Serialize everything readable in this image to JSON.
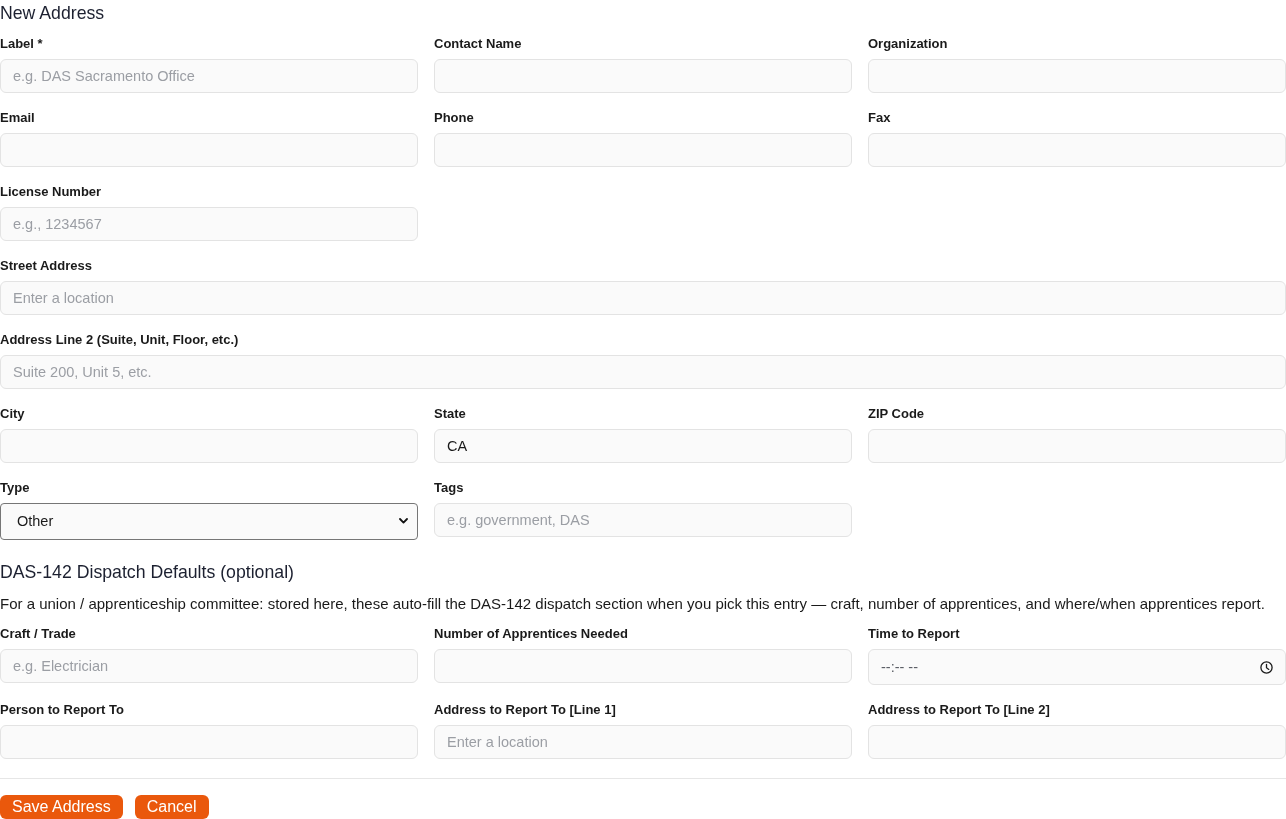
{
  "page": {
    "title": "New Address"
  },
  "sections": [
    {
      "rows": [
        {
          "fields": [
            {
              "label": "Label *",
              "kind": "text",
              "placeholder": "e.g. DAS Sacramento Office"
            },
            {
              "label": "Contact Name",
              "kind": "text"
            },
            {
              "label": "Organization",
              "kind": "text"
            }
          ]
        },
        {
          "fields": [
            {
              "label": "Email",
              "kind": "text"
            },
            {
              "label": "Phone",
              "kind": "text"
            },
            {
              "label": "Fax",
              "kind": "text"
            }
          ]
        },
        {
          "fields": [
            {
              "label": "License Number",
              "kind": "text",
              "placeholder": "e.g., 1234567"
            }
          ]
        },
        {
          "fields": [
            {
              "label": "Street Address",
              "kind": "text",
              "placeholder": "Enter a location"
            }
          ]
        },
        {
          "fields": [
            {
              "label": "Address Line 2 (Suite, Unit, Floor, etc.)",
              "kind": "text",
              "placeholder": "Suite 200, Unit 5, etc."
            }
          ]
        },
        {
          "fields": [
            {
              "label": "City",
              "kind": "text"
            },
            {
              "label": "State",
              "kind": "text",
              "value": "CA"
            },
            {
              "label": "ZIP Code",
              "kind": "text"
            }
          ]
        },
        {
          "fields": [
            {
              "label": "Type",
              "kind": "select",
              "value": "Other"
            },
            {
              "label": "Tags",
              "kind": "text",
              "placeholder": "e.g. government, DAS"
            }
          ]
        }
      ]
    },
    {
      "title": "DAS-142 Dispatch Defaults (optional)",
      "description": "For a union / apprenticeship committee: stored here, these auto-fill the DAS-142 dispatch section when you pick this entry — craft, number of apprentices, and where/when apprentices report.",
      "rows": [
        {
          "fields": [
            {
              "label": "Craft / Trade",
              "kind": "text",
              "placeholder": "e.g. Electrician"
            },
            {
              "label": "Number of Apprentices Needed",
              "kind": "text"
            },
            {
              "label": "Time to Report",
              "kind": "time",
              "placeholder": "--:-- --"
            }
          ]
        },
        {
          "fields": [
            {
              "label": "Person to Report To",
              "kind": "text"
            },
            {
              "label": "Address to Report To [Line 1]",
              "kind": "text",
              "placeholder": "Enter a location"
            },
            {
              "label": "Address to Report To [Line 2]",
              "kind": "text"
            }
          ]
        }
      ]
    }
  ],
  "buttons": [
    {
      "label": "Save Address"
    },
    {
      "label": "Cancel"
    }
  ]
}
